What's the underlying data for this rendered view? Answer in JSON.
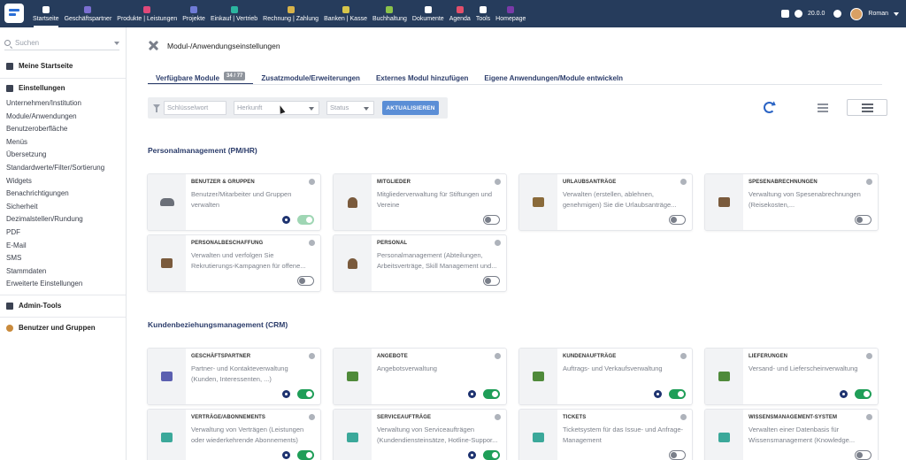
{
  "nav": {
    "items": [
      {
        "label": "Startseite",
        "color": "#ffffff",
        "active": true
      },
      {
        "label": "Geschäftspartner",
        "color": "#7b6fd1",
        "active": false
      },
      {
        "label": "Produkte | Leistungen",
        "color": "#e0497a",
        "active": false
      },
      {
        "label": "Projekte",
        "color": "#6f7bd6",
        "active": false
      },
      {
        "label": "Einkauf | Vertrieb",
        "color": "#2bb5a0",
        "active": false
      },
      {
        "label": "Rechnung | Zahlung",
        "color": "#d7b34a",
        "active": false
      },
      {
        "label": "Banken | Kasse",
        "color": "#d6c54a",
        "active": false
      },
      {
        "label": "Buchhaltung",
        "color": "#8bc34a",
        "active": false
      },
      {
        "label": "Dokumente",
        "color": "#ffffff",
        "active": false
      },
      {
        "label": "Agenda",
        "color": "#e34f6b",
        "active": false
      },
      {
        "label": "Tools",
        "color": "#ffffff",
        "active": false
      },
      {
        "label": "Homepage",
        "color": "#7a3aa8",
        "active": false
      }
    ],
    "version": "20.0.0",
    "user": "Roman"
  },
  "sidebar": {
    "search_placeholder": "Suchen",
    "home_label": "Meine Startseite",
    "settings_label": "Einstellungen",
    "settings_items": [
      "Unternehmen/Institution",
      "Module/Anwendungen",
      "Benutzeroberfläche",
      "Menüs",
      "Übersetzung",
      "Standardwerte/Filter/Sortierung",
      "Widgets",
      "Benachrichtigungen",
      "Sicherheit",
      "Dezimalstellen/Rundung",
      "PDF",
      "E-Mail",
      "SMS",
      "Stammdaten",
      "Erweiterte Einstellungen"
    ],
    "admin_tools_label": "Admin-Tools",
    "users_groups_label": "Benutzer und Gruppen"
  },
  "main": {
    "title": "Modul-/Anwendungseinstellungen",
    "tabs": [
      {
        "label": "Verfügbare Module",
        "badge": "34 / 77",
        "active": true
      },
      {
        "label": "Zusatzmodule/Erweiterungen",
        "badge": "",
        "active": false
      },
      {
        "label": "Externes Modul hinzufügen",
        "badge": "",
        "active": false
      },
      {
        "label": "Eigene Anwendungen/Module entwickeln",
        "badge": "",
        "active": false
      }
    ],
    "filter": {
      "keyword_placeholder": "Schlüsselwort",
      "origin_placeholder": "Herkunft",
      "status_placeholder": "Status",
      "refresh_label": "AKTUALISIEREN"
    },
    "sections": [
      {
        "title": "Personalmanagement (PM/HR)",
        "cards": [
          {
            "title": "BENUTZER & GRUPPEN",
            "desc": "Benutzer/Mitarbeiter und Gruppen verwalten",
            "icon": "users-group-icon",
            "icon_color": "#6b6f78",
            "enabled": true,
            "has_settings": true,
            "soft": true
          },
          {
            "title": "MITGLIEDER",
            "desc": "Mitgliederverwaltung für Stiftungen und Vereine",
            "icon": "member-icon",
            "icon_color": "#7a5a3c",
            "enabled": false,
            "has_settings": false
          },
          {
            "title": "URLAUBSANTRÄGE",
            "desc": "Verwalten (erstellen, ablehnen, genehmigen) Sie die Urlaubsanträge...",
            "icon": "beach-icon",
            "icon_color": "#8a6a3a",
            "enabled": false,
            "has_settings": false
          },
          {
            "title": "SPESENABRECHNUNGEN",
            "desc": "Verwaltung von Spesenabrechnungen (Reisekosten,...",
            "icon": "wallet-icon",
            "icon_color": "#7a5a3c",
            "enabled": false,
            "has_settings": false
          },
          {
            "title": "PERSONALBESCHAFFUNG",
            "desc": "Verwalten und verfolgen Sie Rekrutierungs-Kampagnen für offene...",
            "icon": "id-badge-icon",
            "icon_color": "#7a5a3c",
            "enabled": false,
            "has_settings": false
          },
          {
            "title": "PERSONAL",
            "desc": "Personalmanagement (Abteilungen, Arbeitsverträge, Skill Management und...",
            "icon": "personnel-icon",
            "icon_color": "#7a5a3c",
            "enabled": false,
            "has_settings": false
          }
        ]
      },
      {
        "title": "Kundenbeziehungsmanagement (CRM)",
        "cards": [
          {
            "title": "GESCHÄFTSPARTNER",
            "desc": "Partner- und Kontakteverwaltung (Kunden, Interessenten, ...)",
            "icon": "building-icon",
            "icon_color": "#5b5fb0",
            "enabled": true,
            "has_settings": true
          },
          {
            "title": "ANGEBOTE",
            "desc": "Angebotsverwaltung",
            "icon": "quote-edit-icon",
            "icon_color": "#4f8a3a",
            "enabled": true,
            "has_settings": true
          },
          {
            "title": "KUNDENAUFTRÄGE",
            "desc": "Auftrags- und Verkaufsverwaltung",
            "icon": "order-doc-icon",
            "icon_color": "#4f8a3a",
            "enabled": true,
            "has_settings": true
          },
          {
            "title": "LIEFERUNGEN",
            "desc": "Versand- und Lieferscheinverwaltung",
            "icon": "dolly-icon",
            "icon_color": "#4f8a3a",
            "enabled": true,
            "has_settings": true
          },
          {
            "title": "VERTRÄGE/ABONNEMENTS",
            "desc": "Verwaltung von Verträgen (Leistungen oder wiederkehrende Abonnements)",
            "icon": "suitcase-icon",
            "icon_color": "#3ba89a",
            "enabled": true,
            "has_settings": true
          },
          {
            "title": "SERVICEAUFTRÄGE",
            "desc": "Verwaltung von Serviceaufträgen (Kundendiensteinsätze, Hotline-Suppor...",
            "icon": "truck-icon",
            "icon_color": "#3ba89a",
            "enabled": true,
            "has_settings": true
          },
          {
            "title": "TICKETS",
            "desc": "Ticketsystem für das Issue- und Anfrage-Management",
            "icon": "ticket-icon",
            "icon_color": "#3ba89a",
            "enabled": false,
            "has_settings": false
          },
          {
            "title": "WISSENSMANAGEMENT-SYSTEM",
            "desc": "Verwalten einer Datenbasis für Wissensmanagement (Knowledge...",
            "icon": "knowledge-icon",
            "icon_color": "#3ba89a",
            "enabled": false,
            "has_settings": false
          }
        ]
      }
    ]
  }
}
